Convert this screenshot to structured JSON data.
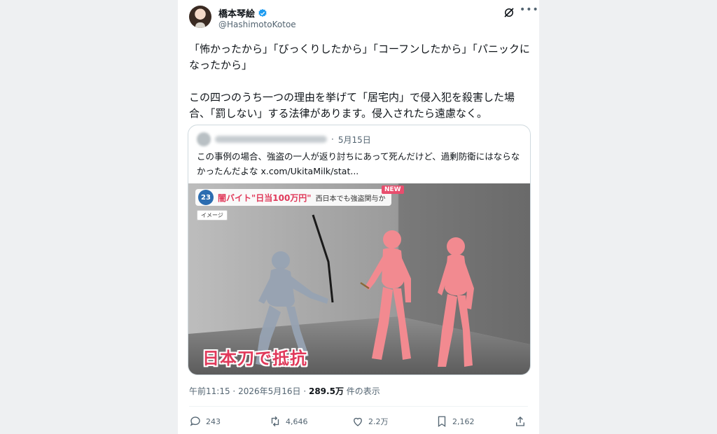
{
  "author": {
    "display_name": "橋本琴絵",
    "handle": "@HashimotoKotoe"
  },
  "icons": {
    "avatar": "profile-avatar",
    "verified": "verified-badge-icon",
    "grok": "grok-icon",
    "more": "more-icon",
    "reply": "reply-icon",
    "retweet": "retweet-icon",
    "like": "heart-icon",
    "bookmark": "bookmark-icon",
    "share": "share-icon"
  },
  "tweet": {
    "text": "「怖かったから」「びっくりしたから」「コーフンしたから」「パニックになったから」\n\nこの四つのうち一つの理由を挙げて「居宅内」で侵入犯を殺害した場合、「罰しない」する法律があります。侵入されたら遠慮なく。"
  },
  "quoted": {
    "date": "5月15日",
    "text": "この事例の場合、強盗の一人が返り討ちにあって死んだけど、過剰防衛にはならなかったんだよな",
    "link": "x.com/UkitaMilk/stat..."
  },
  "media": {
    "channel_number": "23",
    "headline": "闇バイト\"日当100万円\"",
    "subhead": "西日本でも強盗関与か",
    "new_label": "NEW",
    "image_tag": "イメージ",
    "caption": "日本刀で抵抗"
  },
  "meta": {
    "time": "午前11:15",
    "date": "2026年5月16日",
    "views": "289.5万",
    "views_label": "件の表示"
  },
  "stats": {
    "replies": "243",
    "retweets": "4,646",
    "likes": "2.2万",
    "bookmarks": "2,162"
  },
  "colors": {
    "verified_blue": "#1d9bf0",
    "text_primary": "#0f1419",
    "text_secondary": "#536471",
    "headline_red": "#e0395a",
    "figure_red": "#f28a90",
    "figure_gray": "#97a3b3"
  }
}
